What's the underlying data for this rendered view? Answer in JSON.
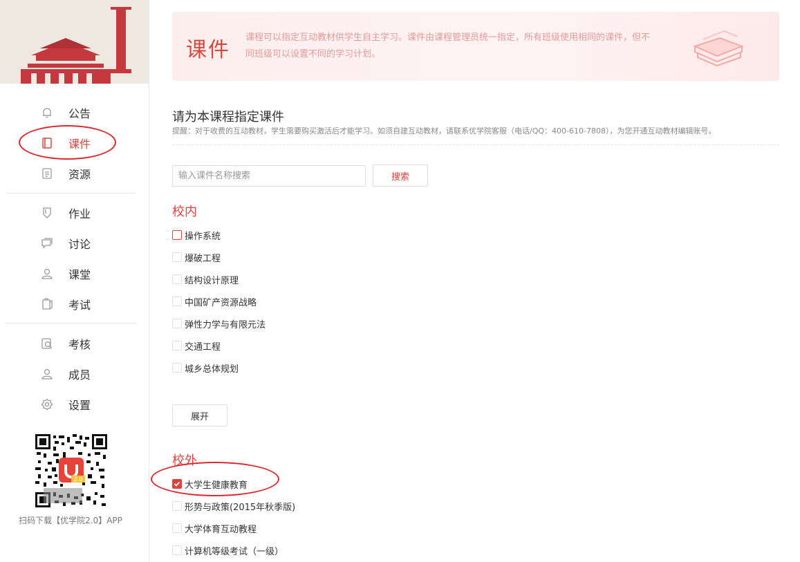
{
  "sidebar": {
    "nav_items": [
      {
        "label": "公告",
        "icon": "bell-icon"
      },
      {
        "label": "课件",
        "icon": "book-icon",
        "active": true
      },
      {
        "label": "资源",
        "icon": "resource-icon"
      },
      {
        "label": "作业",
        "icon": "homework-icon"
      },
      {
        "label": "讨论",
        "icon": "discussion-icon"
      },
      {
        "label": "课堂",
        "icon": "classroom-icon"
      },
      {
        "label": "考试",
        "icon": "exam-icon"
      },
      {
        "label": "考核",
        "icon": "assessment-icon"
      },
      {
        "label": "成员",
        "icon": "member-icon"
      },
      {
        "label": "设置",
        "icon": "settings-icon"
      }
    ],
    "qr_caption": "扫码下载【优学院2.0】APP",
    "qr_badge": "2.0"
  },
  "header": {
    "title": "课件",
    "description": "课程可以指定互动教材供学生自主学习。课件由课程管理员统一指定，所有班级使用相同的课件，但不同班级可以设置不同的学习计划。"
  },
  "section": {
    "title": "请为本课程指定课件",
    "hint": "提醒：对于收费的互动教材，学生需要购买激活后才能学习。如须自建互动教材，请联系优学院客服（电话/QQ：400-610-7808），为您开通互动教材编辑账号。"
  },
  "search": {
    "placeholder": "输入课件名称搜索",
    "button_label": "搜索"
  },
  "groups": {
    "internal": {
      "title": "校内",
      "courses": [
        "操作系统",
        "爆破工程",
        "结构设计原理",
        "中国矿产资源战略",
        "弹性力学与有限元法",
        "交通工程",
        "城乡总体规划"
      ],
      "expand_label": "展开"
    },
    "external": {
      "title": "校外",
      "courses": [
        "大学生健康教育",
        "形势与政策(2015年秋季版)",
        "大学体育互动教程",
        "计算机等级考试（一级）"
      ],
      "checked": "大学生健康教育"
    }
  },
  "colors": {
    "accent": "#d9453d",
    "annotation_circle": "#e0262b"
  }
}
